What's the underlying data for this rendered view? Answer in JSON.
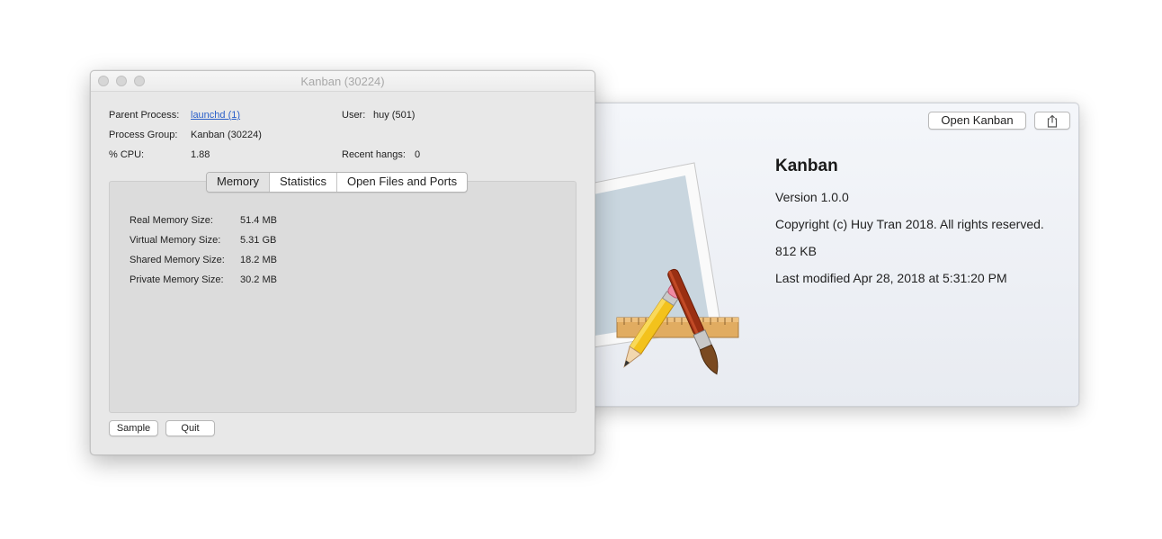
{
  "info_window": {
    "open_button": "Open Kanban",
    "share_icon": "share-icon",
    "app_name": "Kanban",
    "version": "Version 1.0.0",
    "copyright": "Copyright (c) Huy Tran 2018. All rights reserved.",
    "size": "812 KB",
    "modified": "Last modified Apr 28, 2018 at 5:31:20 PM"
  },
  "activity_window": {
    "title": "Kanban (30224)",
    "parent_process": {
      "label": "Parent Process:",
      "value": "launchd (1)"
    },
    "user": {
      "label": "User:",
      "value": "huy (501)"
    },
    "process_group": {
      "label": "Process Group:",
      "value": "Kanban (30224)"
    },
    "cpu": {
      "label": "% CPU:",
      "value": "1.88"
    },
    "recent_hangs": {
      "label": "Recent hangs:",
      "value": "0"
    },
    "tabs": [
      {
        "label": "Memory",
        "active": true
      },
      {
        "label": "Statistics",
        "active": false
      },
      {
        "label": "Open Files and Ports",
        "active": false
      }
    ],
    "memory": [
      {
        "label": "Real Memory Size:",
        "value": "51.4 MB"
      },
      {
        "label": "Virtual Memory Size:",
        "value": "5.31 GB"
      },
      {
        "label": "Shared Memory Size:",
        "value": "18.2 MB"
      },
      {
        "label": "Private Memory Size:",
        "value": "30.2 MB"
      }
    ],
    "sample_button": "Sample",
    "quit_button": "Quit"
  },
  "colors": {
    "link": "#2a5fc9",
    "window_bg": "#e8e8e8",
    "info_bg": "#eef0f5"
  }
}
